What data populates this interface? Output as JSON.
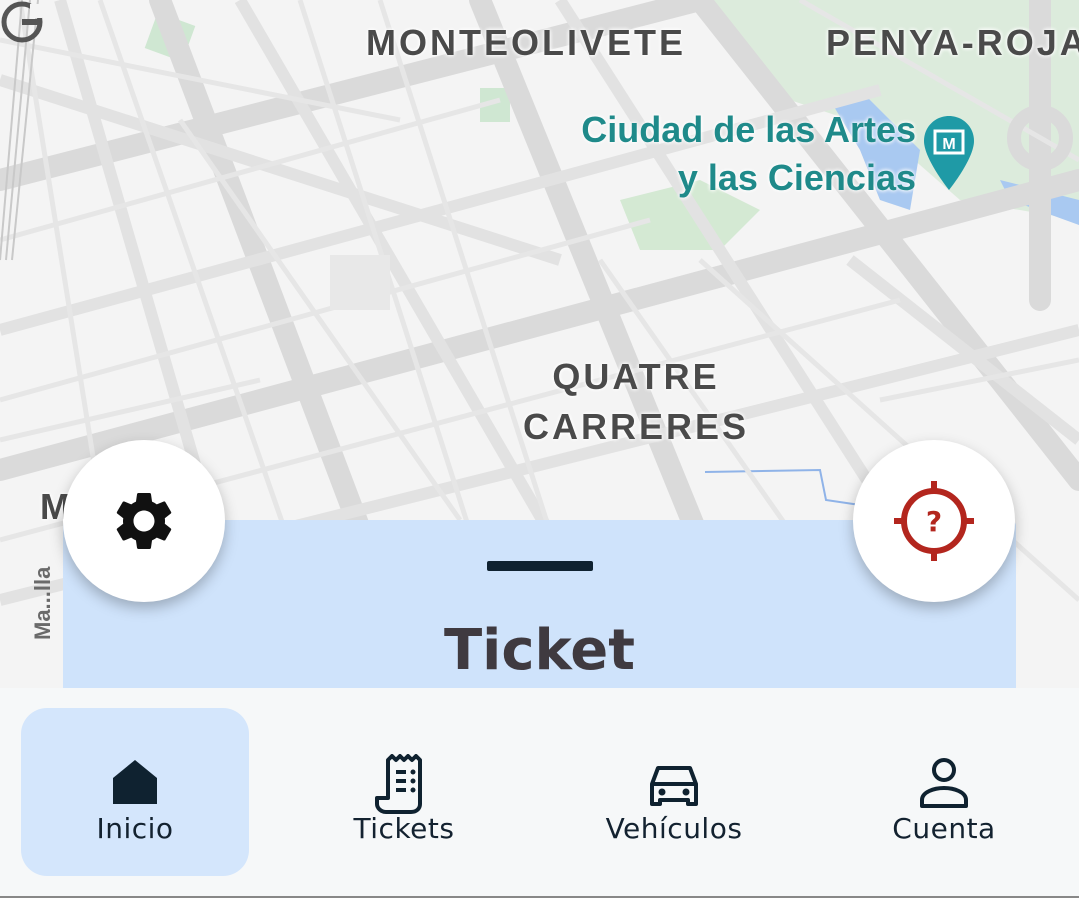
{
  "map": {
    "districts": [
      {
        "id": "monteolivete",
        "text": "MONTEOLIVETE"
      },
      {
        "id": "penya-roja",
        "text": "PENYA-ROJA"
      },
      {
        "id": "quatre-carreres",
        "line1": "QUATRE",
        "line2": "CARRERES"
      },
      {
        "id": "left-edge",
        "text": "M"
      }
    ],
    "poi": {
      "line1": "Ciudad de las Artes",
      "line2": "y las Ciencias",
      "icon": "museum-pin-icon"
    },
    "street_label": "Ma...lla",
    "attribution_icon": "google-g-icon"
  },
  "fabs": {
    "settings": {
      "icon": "gear-icon"
    },
    "locate": {
      "icon": "target-question-icon",
      "color": "#b3261e"
    }
  },
  "sheet": {
    "title": "Ticket",
    "color": "#cfe3fb"
  },
  "nav": {
    "items": [
      {
        "label": "Inicio",
        "icon": "home-icon",
        "active": true
      },
      {
        "label": "Tickets",
        "icon": "receipt-icon",
        "active": false
      },
      {
        "label": "Vehículos",
        "icon": "car-icon",
        "active": false
      },
      {
        "label": "Cuenta",
        "icon": "person-icon",
        "active": false
      }
    ],
    "active_color": "#d4e6fc"
  }
}
